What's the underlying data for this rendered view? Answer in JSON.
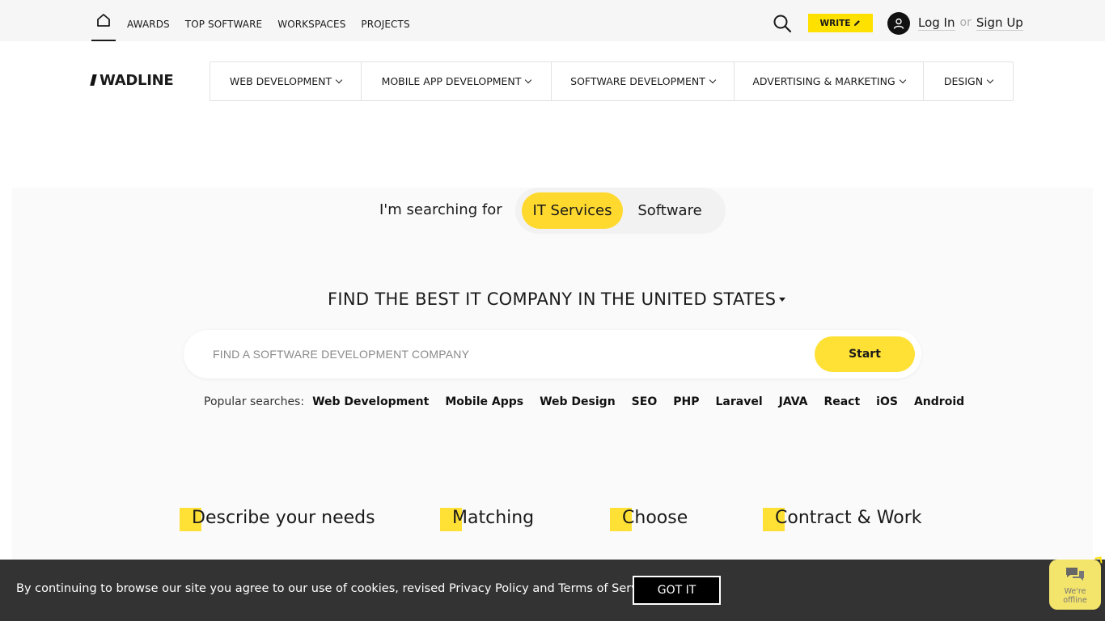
{
  "topbar": {
    "nav": [
      "AWARDS",
      "TOP SOFTWARE",
      "WORKSPACES",
      "PROJECTS"
    ],
    "write_label": "WRITE",
    "login": "Log In",
    "or": "or",
    "signup": "Sign Up"
  },
  "logo": {
    "text": "WADLINE"
  },
  "categories": [
    "WEB DEVELOPMENT",
    "MOBILE APP DEVELOPMENT",
    "SOFTWARE DEVELOPMENT",
    "ADVERTISING & MARKETING",
    "DESIGN"
  ],
  "hero": {
    "searching_label": "I'm searching for",
    "toggle_active": "IT Services",
    "toggle_inactive": "Software",
    "heading_prefix": "FIND THE BEST IT COMPANY IN",
    "heading_country": "THE UNITED STATES",
    "search_placeholder": "FIND A SOFTWARE DEVELOPMENT COMPANY",
    "start_label": "Start",
    "popular_label": "Popular searches:",
    "popular": [
      "Web Development",
      "Mobile Apps",
      "Web Design",
      "SEO",
      "PHP",
      "Laravel",
      "JAVA",
      "React",
      "iOS",
      "Android"
    ]
  },
  "steps": [
    {
      "first": "D",
      "rest": "escribe your needs"
    },
    {
      "first": "M",
      "rest": "atching"
    },
    {
      "first": "C",
      "rest": "hoose"
    },
    {
      "first": "C",
      "rest": "ontract & Work"
    }
  ],
  "cookie": {
    "text": "By continuing to browse our site you agree to  our use of cookies, revised Privacy Policy and Terms of Service.",
    "button": "GOT IT"
  },
  "chat": {
    "status": "We're offline"
  },
  "colors": {
    "accent": "#ffe100",
    "dark": "#333333"
  }
}
